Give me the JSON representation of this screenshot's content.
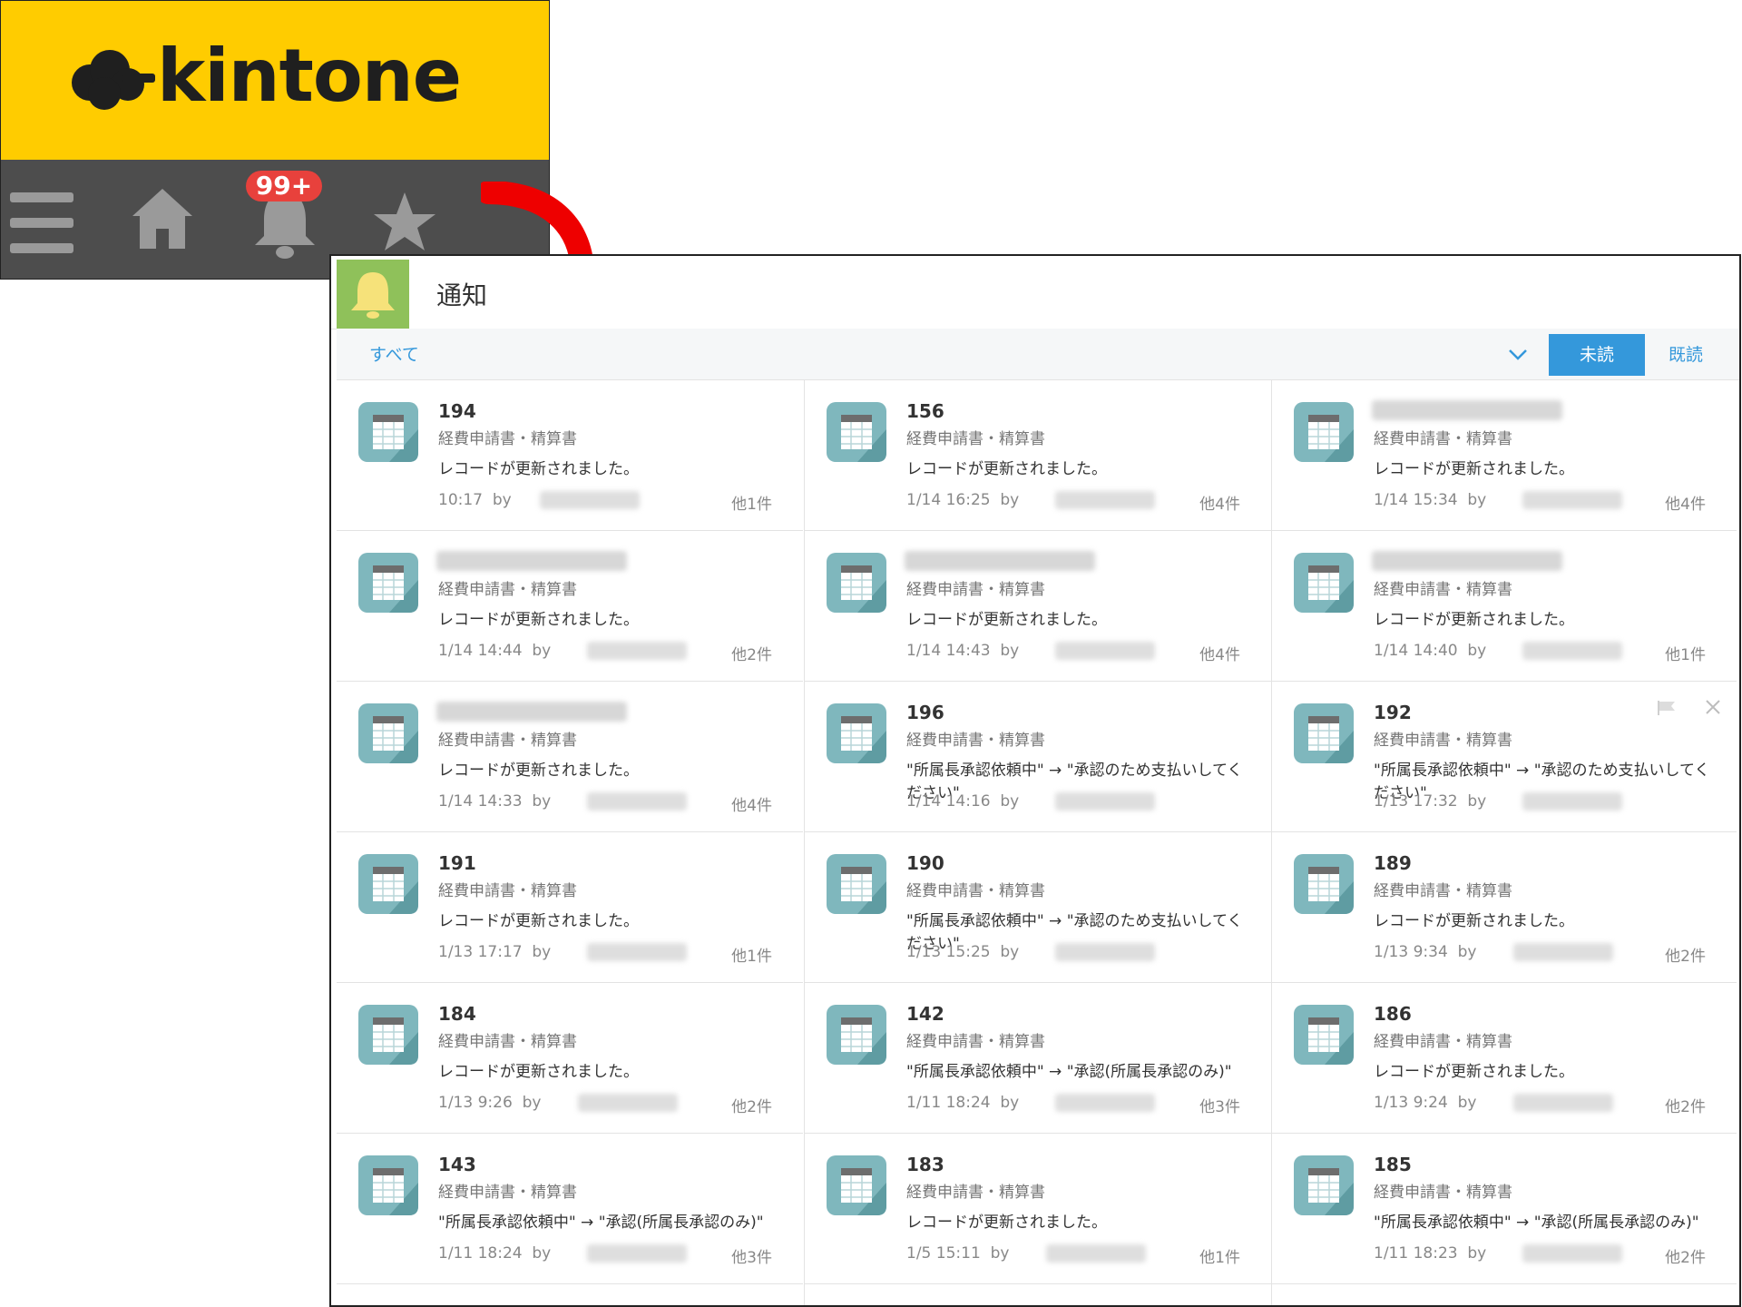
{
  "brand": {
    "logo_text": "kintone",
    "badge": "99+",
    "icons": [
      "menu-icon",
      "home-icon",
      "bell-icon",
      "star-icon"
    ]
  },
  "panel": {
    "title": "通知",
    "filter_all": "すべて",
    "unread_button": "未読",
    "read_button": "既読"
  },
  "colors": {
    "brand_yellow": "#ffcc00",
    "nav_gray": "#4d4d4d",
    "accent_blue": "#3498db",
    "badge_red": "#e8413c",
    "bell_green": "#8fc15a",
    "app_icon_teal": "#7fb7bd"
  },
  "columns": [
    [
      {
        "title": "194",
        "app": "経費申請書・精算書",
        "message": "レコードが更新されました。",
        "time": "10:17",
        "by": "by",
        "others": "他1件"
      },
      {
        "title": "",
        "app": "経費申請書・精算書",
        "message": "レコードが更新されました。",
        "time": "1/14 14:44",
        "by": "by",
        "others": "他2件"
      },
      {
        "title": "",
        "app": "経費申請書・精算書",
        "message": "レコードが更新されました。",
        "time": "1/14 14:33",
        "by": "by",
        "others": "他4件"
      },
      {
        "title": "191",
        "app": "経費申請書・精算書",
        "message": "レコードが更新されました。",
        "time": "1/13 17:17",
        "by": "by",
        "others": "他1件"
      },
      {
        "title": "184",
        "app": "経費申請書・精算書",
        "message": "レコードが更新されました。",
        "time": "1/13 9:26",
        "by": "by",
        "others": "他2件"
      },
      {
        "title": "143",
        "app": "経費申請書・精算書",
        "message": "\"所属長承認依頼中\" → \"承認(所属長承認のみ)\"",
        "time": "1/11 18:24",
        "by": "by",
        "others": "他3件"
      }
    ],
    [
      {
        "title": "156",
        "app": "経費申請書・精算書",
        "message": "レコードが更新されました。",
        "time": "1/14 16:25",
        "by": "by",
        "others": "他4件"
      },
      {
        "title": "",
        "app": "経費申請書・精算書",
        "message": "レコードが更新されました。",
        "time": "1/14 14:43",
        "by": "by",
        "others": "他4件"
      },
      {
        "title": "196",
        "app": "経費申請書・精算書",
        "message": "\"所属長承認依頼中\" → \"承認のため支払いしてください\"",
        "time": "1/14 14:16",
        "by": "by",
        "others": ""
      },
      {
        "title": "190",
        "app": "経費申請書・精算書",
        "message": "\"所属長承認依頼中\" → \"承認のため支払いしてください\"",
        "time": "1/13 15:25",
        "by": "by",
        "others": ""
      },
      {
        "title": "142",
        "app": "経費申請書・精算書",
        "message": "\"所属長承認依頼中\" → \"承認(所属長承認のみ)\"",
        "time": "1/11 18:24",
        "by": "by",
        "others": "他3件"
      },
      {
        "title": "183",
        "app": "経費申請書・精算書",
        "message": "レコードが更新されました。",
        "time": "1/5 15:11",
        "by": "by",
        "others": "他1件"
      }
    ],
    [
      {
        "title": "",
        "app": "経費申請書・精算書",
        "message": "レコードが更新されました。",
        "time": "1/14 15:34",
        "by": "by",
        "others": "他4件"
      },
      {
        "title": "",
        "app": "経費申請書・精算書",
        "message": "レコードが更新されました。",
        "time": "1/14 14:40",
        "by": "by",
        "others": "他1件"
      },
      {
        "title": "192",
        "app": "経費申請書・精算書",
        "message": "\"所属長承認依頼中\" → \"承認のため支払いしてください\"",
        "time": "1/13 17:32",
        "by": "by",
        "others": ""
      },
      {
        "title": "189",
        "app": "経費申請書・精算書",
        "message": "レコードが更新されました。",
        "time": "1/13 9:34",
        "by": "by",
        "others": "他2件"
      },
      {
        "title": "186",
        "app": "経費申請書・精算書",
        "message": "レコードが更新されました。",
        "time": "1/13 9:24",
        "by": "by",
        "others": "他2件"
      },
      {
        "title": "185",
        "app": "経費申請書・精算書",
        "message": "\"所属長承認依頼中\" → \"承認(所属長承認のみ)\"",
        "time": "1/11 18:23",
        "by": "by",
        "others": "他2件"
      }
    ]
  ]
}
